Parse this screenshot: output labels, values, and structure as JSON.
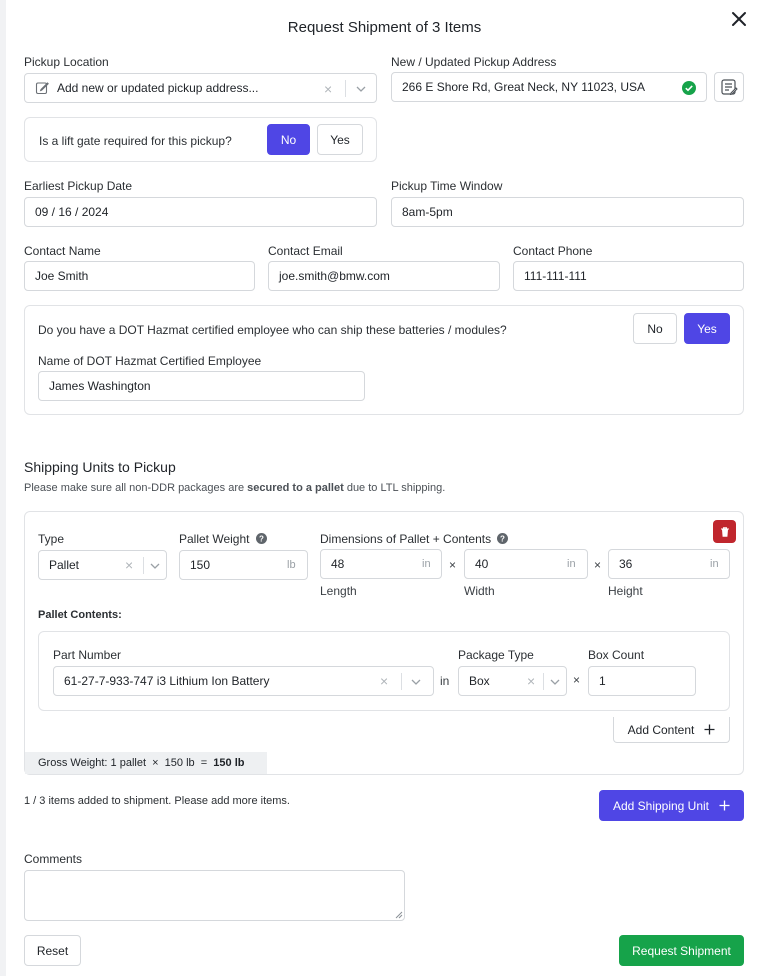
{
  "modal": {
    "title": "Request Shipment of 3 Items"
  },
  "pickup": {
    "location_label": "Pickup Location",
    "location_value": "Add new or updated pickup address...",
    "address_label": "New / Updated Pickup Address",
    "address_value": "266 E Shore Rd, Great Neck, NY 11023, USA",
    "liftgate_question": "Is a lift gate required for this pickup?",
    "liftgate_no": "No",
    "liftgate_yes": "Yes",
    "date_label": "Earliest Pickup Date",
    "date_value": "09 / 16 / 2024",
    "window_label": "Pickup Time Window",
    "window_value": "8am-5pm"
  },
  "contact": {
    "name_label": "Contact Name",
    "name_value": "Joe Smith",
    "email_label": "Contact Email",
    "email_value": "joe.smith@bmw.com",
    "phone_label": "Contact Phone",
    "phone_value": "111-111-111"
  },
  "hazmat": {
    "question": "Do you have a DOT Hazmat certified employee who can ship these batteries / modules?",
    "no": "No",
    "yes": "Yes",
    "employee_label": "Name of DOT Hazmat Certified Employee",
    "employee_value": "James Washington"
  },
  "units": {
    "heading": "Shipping Units to Pickup",
    "note_pre": "Please make sure all non-DDR packages are ",
    "note_bold": "secured to a pallet",
    "note_post": " due to LTL shipping.",
    "type_label": "Type",
    "type_value": "Pallet",
    "weight_label": "Pallet Weight",
    "weight_value": "150",
    "weight_unit": "lb",
    "dims_label": "Dimensions of Pallet + Contents",
    "length_value": "48",
    "width_value": "40",
    "height_value": "36",
    "dim_unit": "in",
    "times": "×",
    "length_label": "Length",
    "width_label": "Width",
    "height_label": "Height",
    "contents_label": "Pallet Contents:",
    "part_label": "Part Number",
    "part_value": "61-27-7-933-747 i3 Lithium Ion Battery",
    "in_word": "in",
    "package_label": "Package Type",
    "package_value": "Box",
    "count_label": "Box Count",
    "count_value": "1",
    "add_content": "Add Content",
    "gross_pre": "Gross Weight: 1 pallet  ×  150 lb  =  ",
    "gross_total": "150 lb"
  },
  "footer": {
    "status": "1 / 3 items added to shipment. Please add more items.",
    "add_unit": "Add Shipping Unit",
    "comments_label": "Comments",
    "comments_value": "",
    "reset": "Reset",
    "request": "Request Shipment"
  },
  "colors": {
    "accent": "#4f46e5",
    "success": "#16a34a",
    "danger": "#c0262d"
  }
}
